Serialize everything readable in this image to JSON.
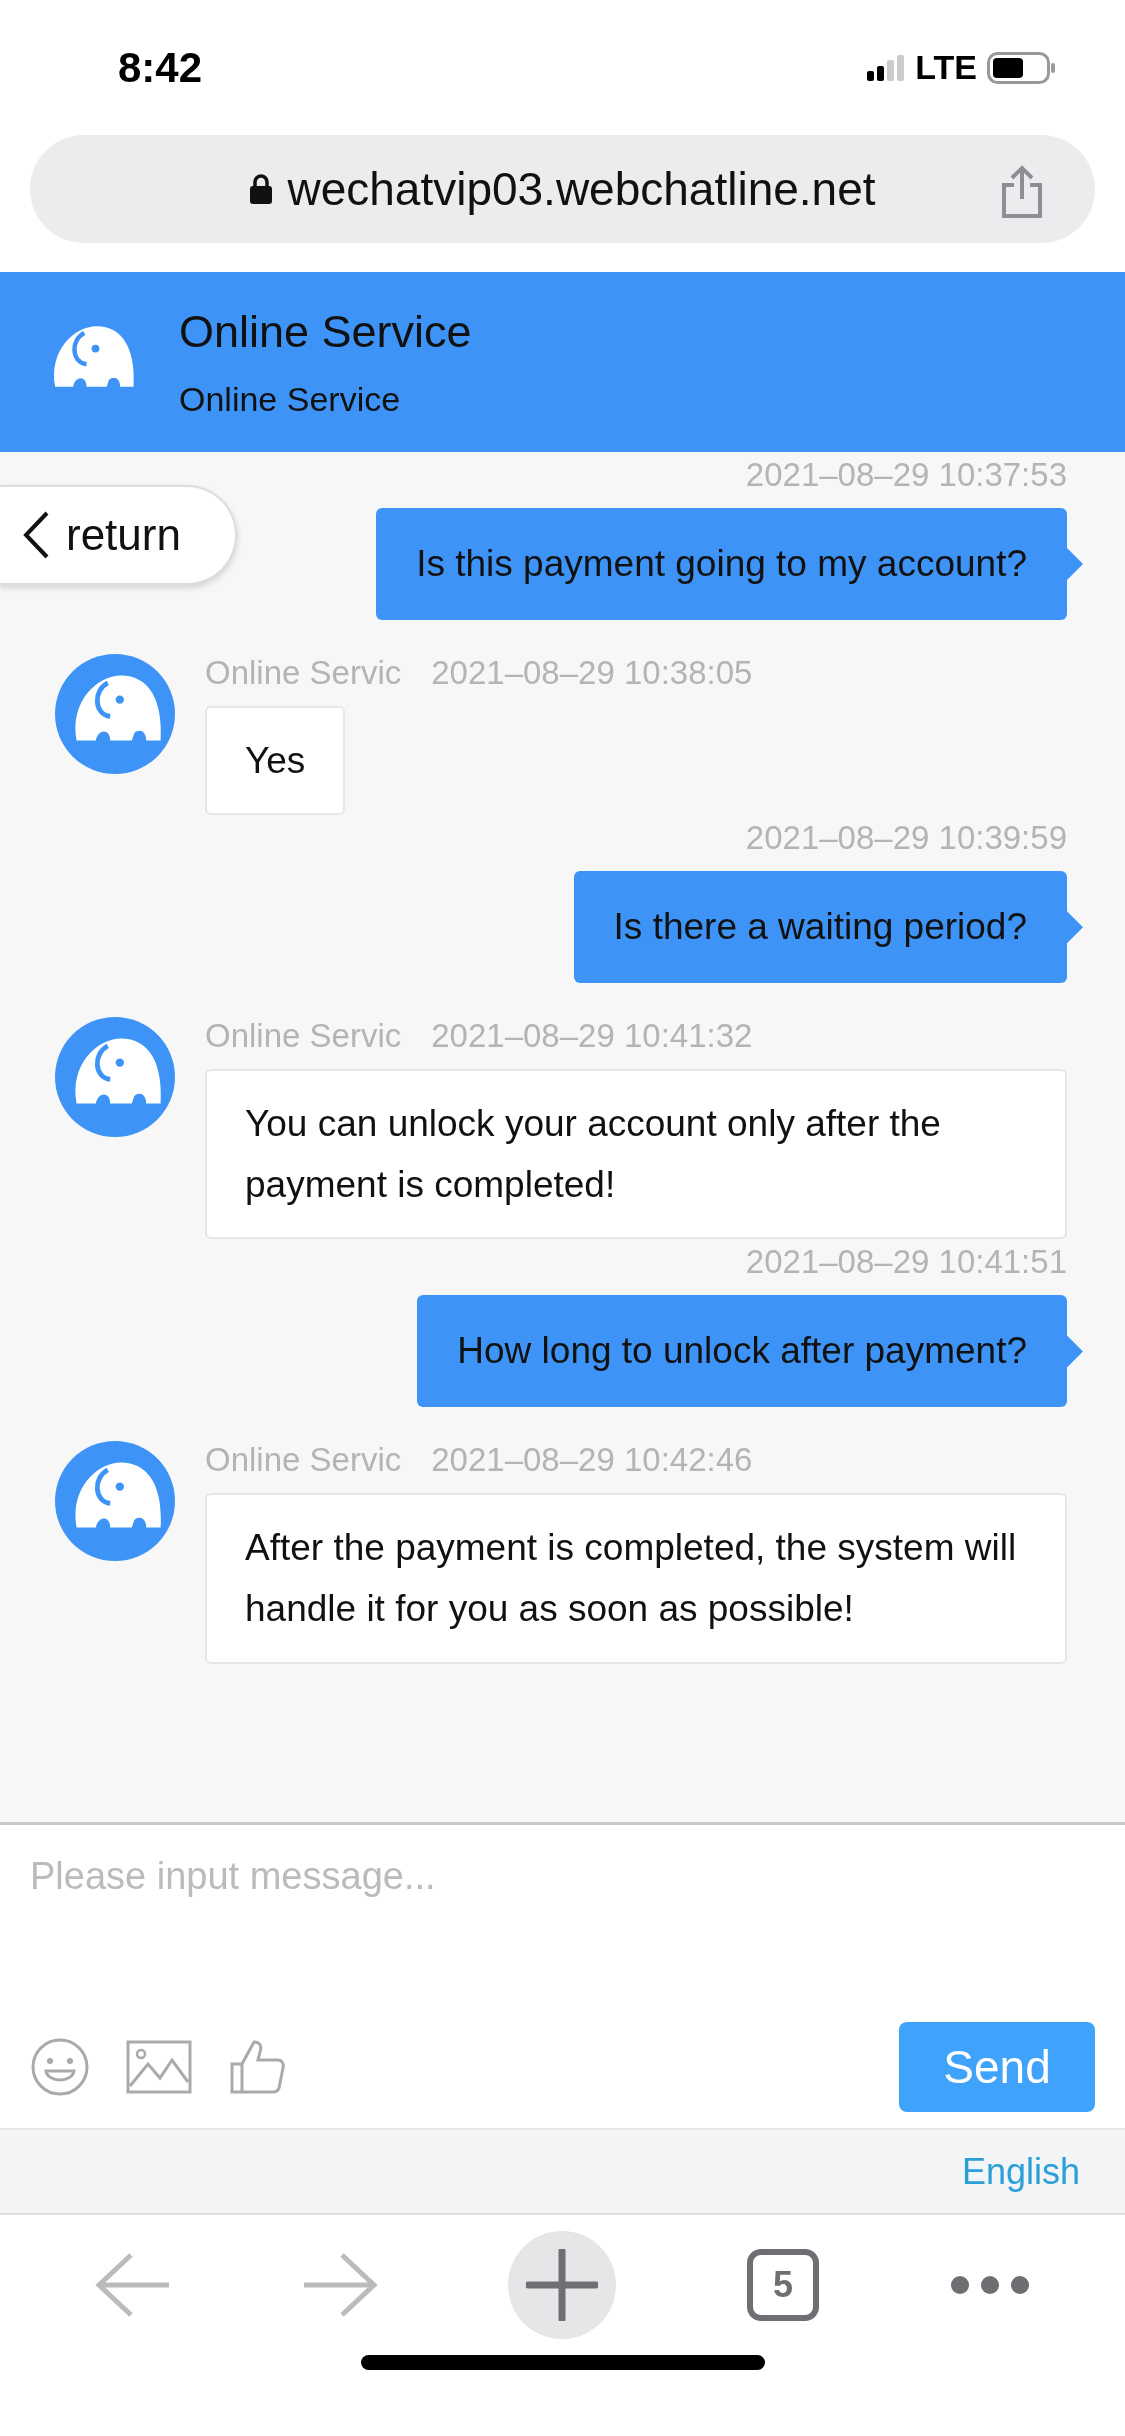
{
  "status_bar": {
    "time": "8:42",
    "network": "LTE"
  },
  "address_bar": {
    "url": "wechatvip03.webchatline.net"
  },
  "header": {
    "title": "Online Service",
    "subtitle": "Online Service"
  },
  "return_button": {
    "label": "return"
  },
  "messages": [
    {
      "kind": "outgoing",
      "timestamp": "2021–08–29 10:37:53",
      "text": "Is this payment going to my account?"
    },
    {
      "kind": "incoming",
      "sender": "Online Servic",
      "timestamp": "2021–08–29 10:38:05",
      "text": "Yes"
    },
    {
      "kind": "outgoing",
      "timestamp": "2021–08–29 10:39:59",
      "text": "Is there a waiting period?"
    },
    {
      "kind": "incoming",
      "sender": "Online Servic",
      "timestamp": "2021–08–29 10:41:32",
      "text": "You can unlock your account only after the payment is completed!"
    },
    {
      "kind": "outgoing",
      "timestamp": "2021–08–29 10:41:51",
      "text": "How long to unlock after payment?"
    },
    {
      "kind": "incoming",
      "sender": "Online Servic",
      "timestamp": "2021–08–29 10:42:46",
      "text": "After the payment is completed, the system will handle it for you as soon as possible!"
    }
  ],
  "composer": {
    "placeholder": "Please input message...",
    "send_label": "Send"
  },
  "language": "English",
  "browser_toolbar": {
    "tab_count": "5"
  }
}
